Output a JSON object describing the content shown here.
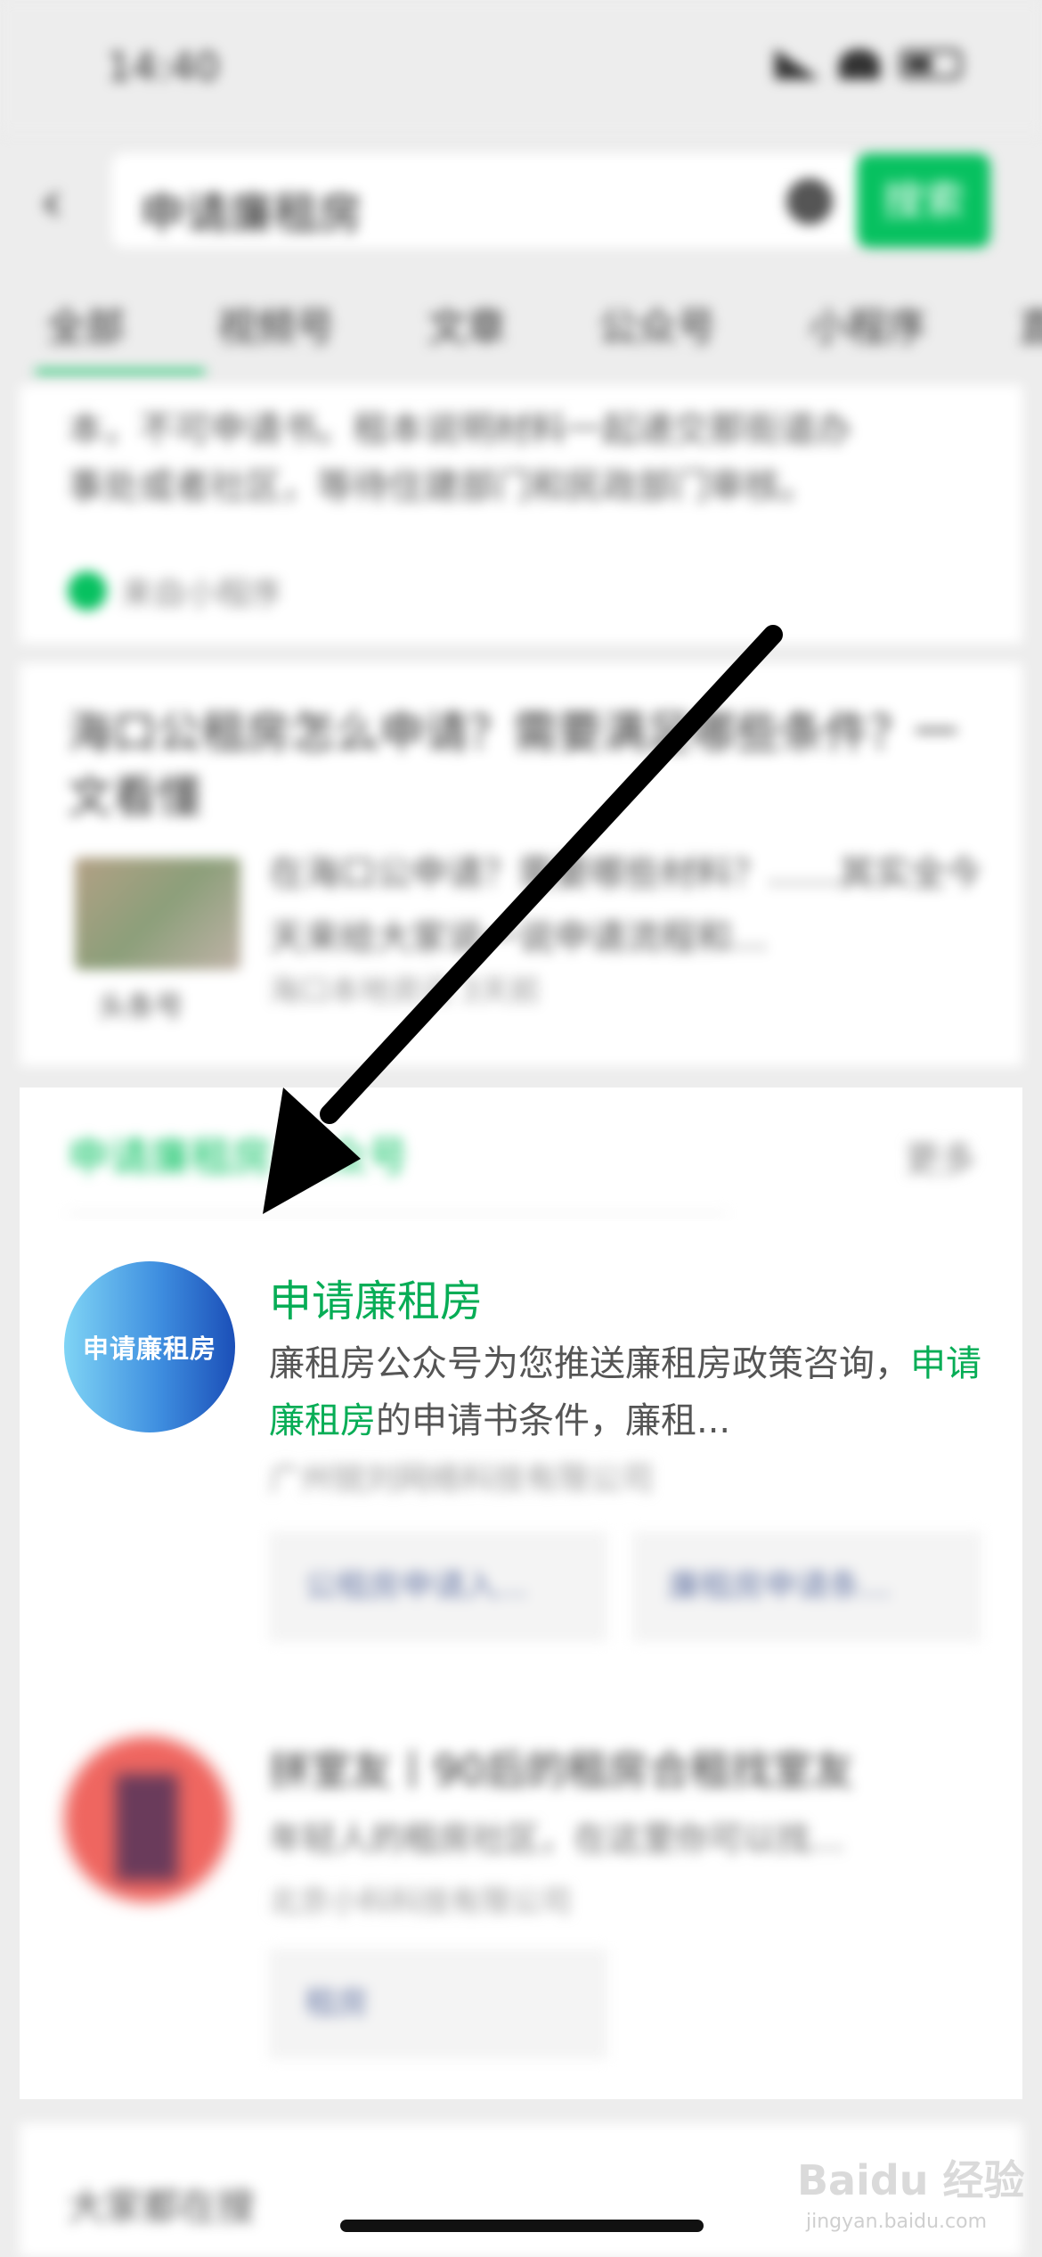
{
  "status_bar": {
    "time": "14:40"
  },
  "search": {
    "back_icon": "chevron-left-icon",
    "value": "申请廉租房",
    "clear_icon": "clear-icon",
    "button_label": "搜索",
    "accent": "#07c160"
  },
  "tabs": [
    "全部",
    "视频号",
    "文章",
    "公众号",
    "小程序",
    "直"
  ],
  "card1": {
    "lines": [
      "本，不可申请书。租本说明材料一起递交那街道办",
      "事处或者社区，等待住建部门和民政部门审核。"
    ],
    "source": "来自小程序"
  },
  "card2": {
    "title": "海口公租房怎么申请？需要满足哪些条件？一文看懂",
    "thumb_label": "头条号",
    "snippet": "在海口公申请？需要哪些材料？……其实全今天来给大家说一说申请流程和…",
    "meta": "海口本地资讯 3天前"
  },
  "card3": {
    "section_title": "申请廉租房 公众号",
    "more": "更多",
    "item1": {
      "name": "申请廉租房",
      "avatar_text": "申请廉租房",
      "desc_prefix": "廉租房公众号为您推送廉租房政策咨询，",
      "desc_highlight": "申请廉租房",
      "desc_suffix": "的申请书条件，廉租...",
      "company": "广州锐刘网络科技有限公司",
      "menu": [
        "公租房申请入...",
        "廉租房申请条..."
      ]
    },
    "item2": {
      "title": "拼室友丨90后的租房合租找室友",
      "desc": "年轻人的租房社区，在这里你可以找…",
      "company": "北京小科科技有限公司",
      "menu": [
        "租房"
      ]
    }
  },
  "card4": {
    "label": "大家都在搜"
  },
  "watermark": {
    "brand": "Baidu 经验",
    "url": "jingyan.baidu.com"
  },
  "highlight_color": "#07ad56"
}
